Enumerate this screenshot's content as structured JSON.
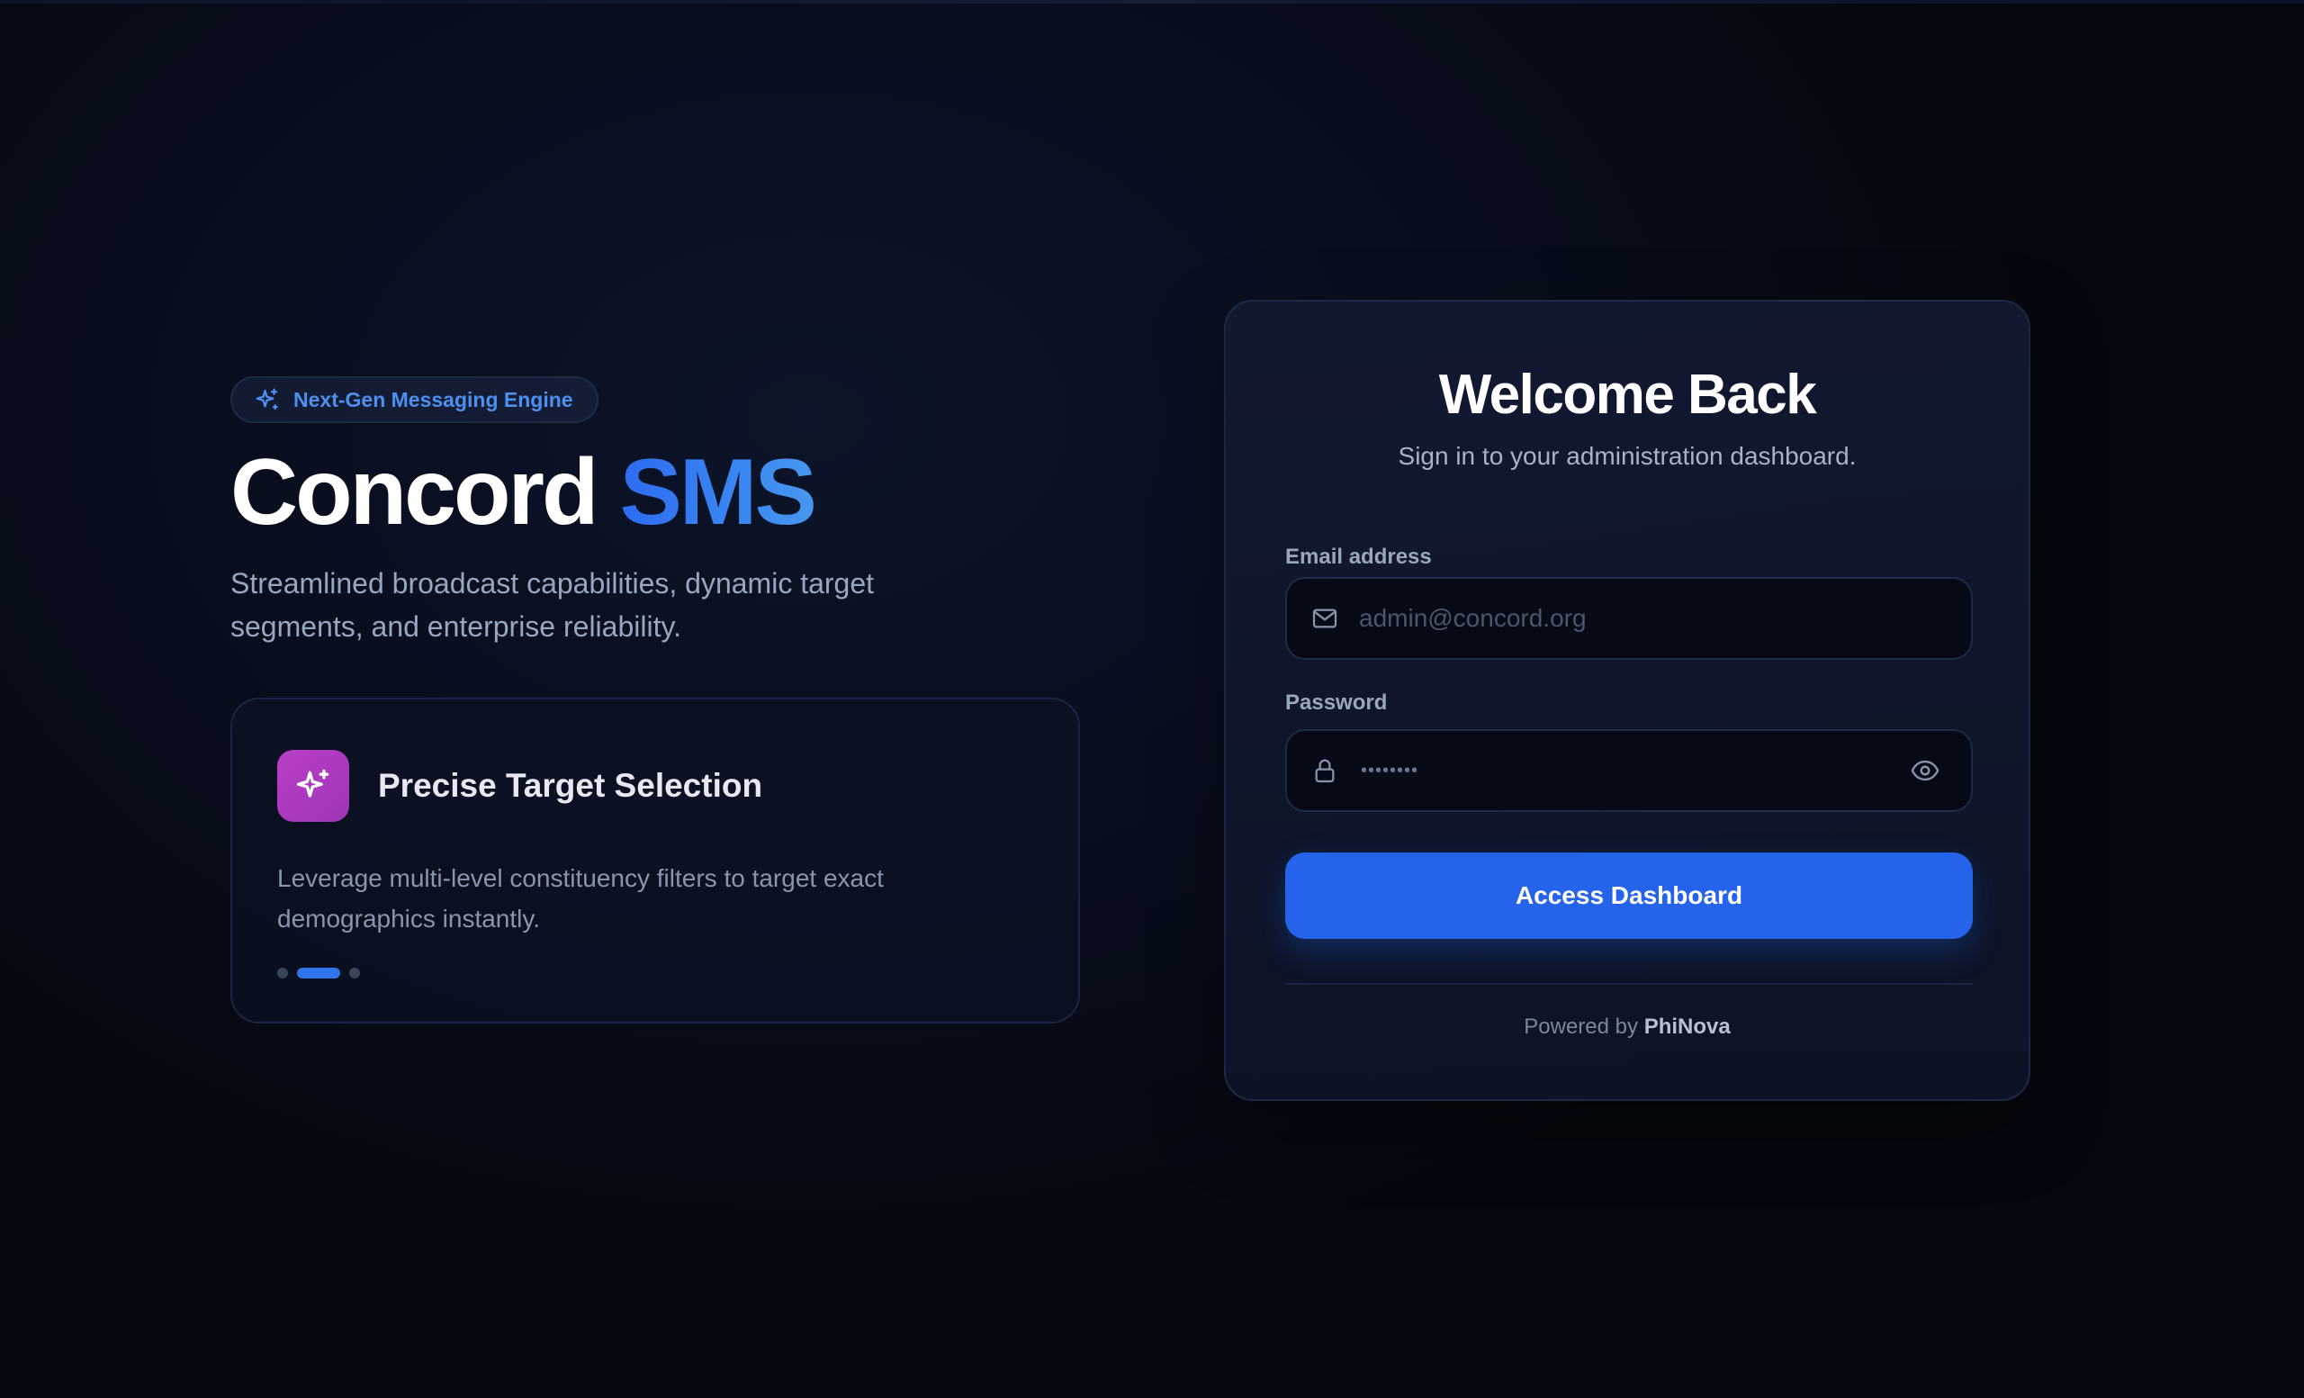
{
  "hero": {
    "badge_label": "Next-Gen Messaging Engine",
    "badge_icon": "sparkles-icon",
    "title_main": "Concord",
    "title_accent": "SMS",
    "subtitle": "Streamlined broadcast capabilities, dynamic target segments, and enterprise reliability."
  },
  "feature": {
    "icon": "sparkle-icon",
    "icon_color": "#b13dc3",
    "title": "Precise Target Selection",
    "description": "Leverage multi-level constituency filters to target exact demographics instantly.",
    "carousel_total": 3,
    "carousel_active_index": 1
  },
  "login": {
    "title": "Welcome Back",
    "subtitle": "Sign in to your administration dashboard.",
    "email_label": "Email address",
    "email_placeholder": "admin@concord.org",
    "email_icon": "mail-icon",
    "password_label": "Password",
    "password_value": "••••••••",
    "password_icon": "lock-icon",
    "password_toggle_icon": "eye-icon",
    "submit_label": "Access Dashboard",
    "powered_prefix": "Powered by",
    "powered_brand": "PhiNova"
  },
  "colors": {
    "accent": "#2563eb",
    "badge_text": "#4c8ff0",
    "background": "#080d1c"
  }
}
